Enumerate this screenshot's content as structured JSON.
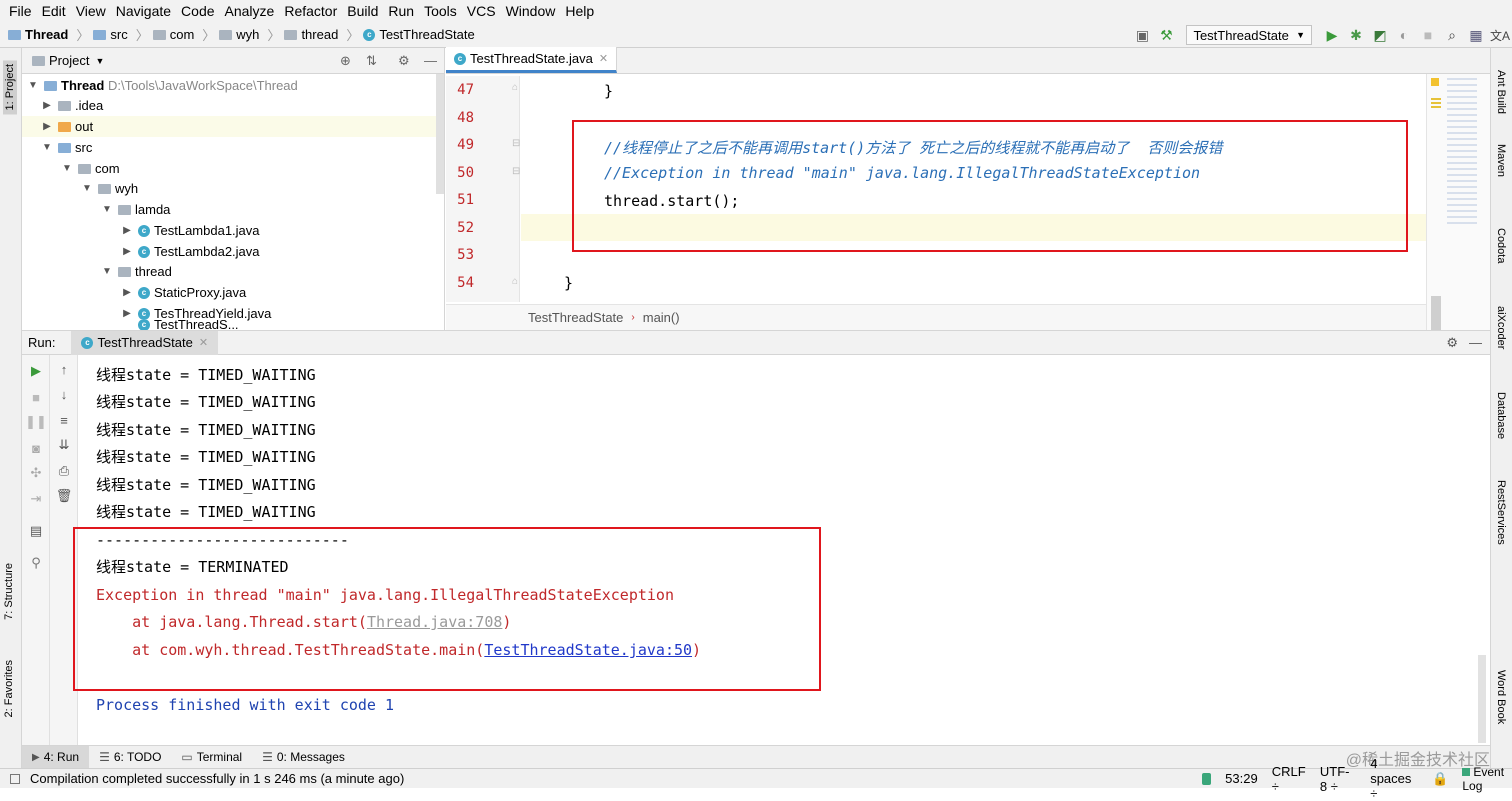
{
  "menu": [
    "File",
    "Edit",
    "View",
    "Navigate",
    "Code",
    "Analyze",
    "Refactor",
    "Build",
    "Run",
    "Tools",
    "VCS",
    "Window",
    "Help"
  ],
  "breadcrumb": [
    "Thread",
    "src",
    "com",
    "wyh",
    "thread",
    "TestThreadState"
  ],
  "toolbar": {
    "run_config": "TestThreadState"
  },
  "left_strip": {
    "project": "1: Project",
    "structure": "7: Structure",
    "favorites": "2: Favorites"
  },
  "right_strip": [
    "Ant Build",
    "Maven",
    "Codota",
    "aiXcoder",
    "Database",
    "RestServices",
    "Word Book"
  ],
  "project": {
    "title": "Project",
    "root_name": "Thread",
    "root_path": "D:\\Tools\\JavaWorkSpace\\Thread",
    "items": [
      ".idea",
      "out",
      "src",
      "com",
      "wyh",
      "lamda",
      "TestLambda1.java",
      "TestLambda2.java",
      "thread",
      "StaticProxy.java",
      "TesThreadYield.java",
      "TestThreadS..."
    ]
  },
  "editor": {
    "tab": "TestThreadState.java",
    "line_numbers": [
      "47",
      "48",
      "49",
      "50",
      "51",
      "52",
      "53",
      "54"
    ],
    "lines": [
      "}",
      "",
      "//线程停止了之后不能再调用start()方法了 死亡之后的线程就不能再启动了  否则会报错",
      "//Exception in thread \"main\" java.lang.IllegalThreadStateException",
      "thread.start();",
      "",
      "",
      "}"
    ],
    "crumbs": [
      "TestThreadState",
      "main()"
    ]
  },
  "run": {
    "label": "Run:",
    "tab": "TestThreadState",
    "output": [
      "线程state = TIMED_WAITING",
      "线程state = TIMED_WAITING",
      "线程state = TIMED_WAITING",
      "线程state = TIMED_WAITING",
      "线程state = TIMED_WAITING",
      "线程state = TIMED_WAITING",
      "----------------------------",
      "线程state = TERMINATED",
      "Exception in thread \"main\" java.lang.IllegalThreadStateException"
    ],
    "trace1_prefix": "    at java.lang.Thread.start(",
    "trace1_link": "Thread.java:708",
    "trace2_prefix": "    at com.wyh.thread.TestThreadState.main(",
    "trace2_link": "TestThreadState.java:50",
    "close_paren": ")",
    "exit": "Process finished with exit code 1"
  },
  "bottom_tabs": [
    "4: Run",
    "6: TODO",
    "Terminal",
    "0: Messages"
  ],
  "status": {
    "message": "Compilation completed successfully in 1 s 246 ms (a minute ago)",
    "position": "53:29",
    "line_sep": "CRLF ÷",
    "encoding": "UTF-8 ÷",
    "indent": "4 spaces ÷",
    "event_log": "Event Log",
    "watermark": "@稀土掘金技术社区"
  }
}
